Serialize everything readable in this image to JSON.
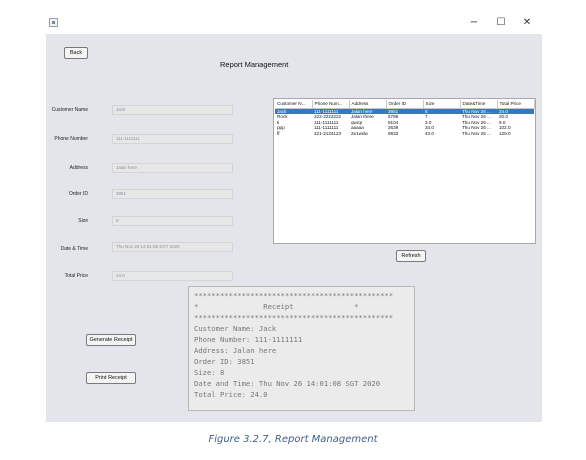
{
  "window": {
    "min_glyph": "−",
    "max_glyph": "☐",
    "close_glyph": "✕"
  },
  "toolbar": {
    "back_label": "Back"
  },
  "page": {
    "title": "Report Management"
  },
  "form": {
    "fields": [
      {
        "label": "Customer Name",
        "value": "Jack"
      },
      {
        "label": "Phone Number",
        "value": "111-1111111"
      },
      {
        "label": "Address",
        "value": "Jalan here"
      },
      {
        "label": "Order ID",
        "value": "3851"
      },
      {
        "label": "Size",
        "value": "8"
      },
      {
        "label": "Date & Time",
        "value": "Thu Nov 26 14:01:08 SGT 2020"
      },
      {
        "label": "Total Price",
        "value": "24.0"
      }
    ]
  },
  "table": {
    "columns": [
      "Customer N...",
      "Phone Num...",
      "Address",
      "Order ID",
      "Size",
      "Date&Time",
      "Total Price"
    ],
    "rows": [
      [
        "Jack",
        "111-1111111",
        "Jalan here",
        "3851",
        "8",
        "Thu Nov 26 ...",
        "24.0"
      ],
      [
        "Rock",
        "222-2222222",
        "Jalan there",
        "5788",
        "7",
        "Thu Nov 26 ...",
        "20.0"
      ],
      [
        "ti",
        "111-1111111",
        "qwrqr",
        "9104",
        "3.0",
        "Thu Nov 26 ...",
        "9.0"
      ],
      [
        "ppp",
        "111-1111111",
        "aaaaa",
        "2639",
        "34.0",
        "Thu Nov 26 ...",
        "102.0"
      ],
      [
        "ff",
        "321-2134123",
        "2e1wdw",
        "9933",
        "43.0",
        "Thu Nov 26 ...",
        "129.0"
      ]
    ],
    "selected_row": 0
  },
  "actions": {
    "refresh_label": "Refresh",
    "generate_label": "Generate Receipt",
    "print_label": "Print Receipt"
  },
  "receipt": {
    "lines": [
      "**********************************************",
      "*               Receipt              *",
      "**********************************************",
      "Customer Name: Jack",
      "Phone Number: 111-1111111",
      "Address: Jalan here",
      "Order ID: 3851",
      "Size: 8",
      "Date and Time: Thu Nov 26 14:01:08 SGT 2020",
      "Total Price: 24.0"
    ]
  },
  "caption": "Figure 3.2.7, Report Management",
  "colors": {
    "selection": "#3877c0",
    "caption": "#3f5f8a"
  }
}
